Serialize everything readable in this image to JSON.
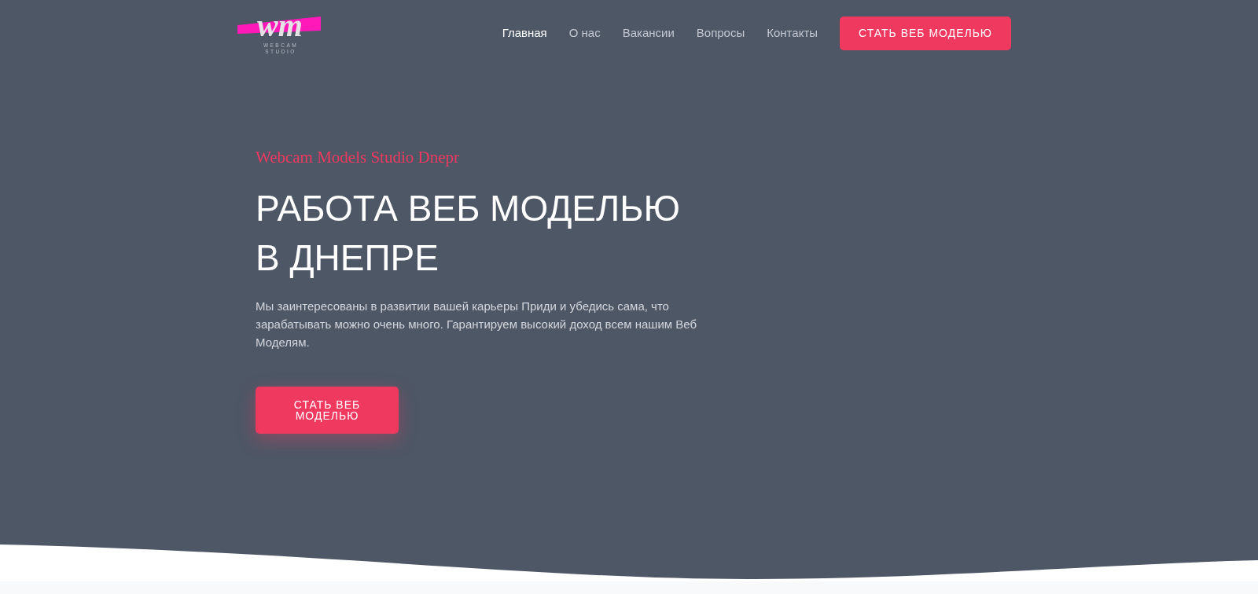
{
  "logo": {
    "monogram": "wm",
    "caption": [
      "WEBCAM",
      "STUDIO"
    ]
  },
  "nav": {
    "links": [
      {
        "label": "Главная",
        "selected": true
      },
      {
        "label": "О нас",
        "selected": false
      },
      {
        "label": "Вакансии",
        "selected": false
      },
      {
        "label": "Вопросы",
        "selected": false
      },
      {
        "label": "Контакты",
        "selected": false
      }
    ],
    "cta": "СТАТЬ ВЕБ МОДЕЛЬЮ"
  },
  "hero": {
    "tagline": "Webcam Models Studio Dnepr",
    "heading": "РАБОТА ВЕБ МОДЕЛЬЮ В ДНЕПРЕ",
    "text": "Мы заинтересованы в развитии вашей карьеры Приди и убедись сама, что зарабатывать можно очень много. Гарантируем высокий доход всем нашим Веб Моделям.",
    "button": "СТАТЬ ВЕБ МОДЕЛЬЮ"
  }
}
